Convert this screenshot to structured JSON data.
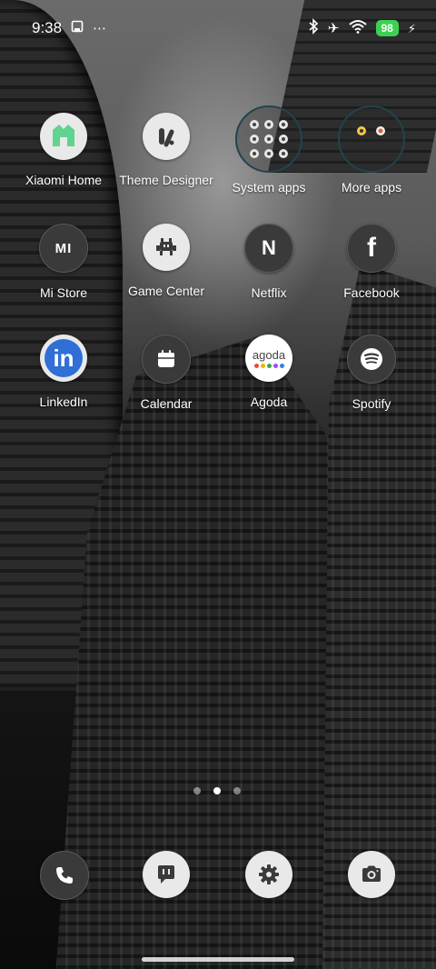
{
  "status_bar": {
    "time": "9:38",
    "left_icons": [
      "screenshot-icon",
      "more-notifications-icon"
    ],
    "right_icons": [
      "bluetooth-icon",
      "airplane-mode-icon",
      "wifi-icon",
      "charging-icon"
    ],
    "battery_level": "98",
    "battery_color": "#3dd153"
  },
  "apps": [
    {
      "name": "xiaomi-home",
      "label": "Xiaomi Home"
    },
    {
      "name": "theme-designer",
      "label": "Theme Designer"
    },
    {
      "name": "system-apps-folder",
      "label": "System apps"
    },
    {
      "name": "more-apps-folder",
      "label": "More apps"
    },
    {
      "name": "mi-store",
      "label": "Mi Store",
      "glyph": "MI"
    },
    {
      "name": "game-center",
      "label": "Game Center"
    },
    {
      "name": "netflix",
      "label": "Netflix",
      "glyph": "N"
    },
    {
      "name": "facebook",
      "label": "Facebook",
      "glyph": "f"
    },
    {
      "name": "linkedin",
      "label": "LinkedIn",
      "glyph": "in"
    },
    {
      "name": "calendar",
      "label": "Calendar"
    },
    {
      "name": "agoda",
      "label": "Agoda",
      "glyph": "agoda"
    },
    {
      "name": "spotify",
      "label": "Spotify"
    }
  ],
  "page_indicator": {
    "pages": 3,
    "current": 2
  },
  "dock": [
    {
      "name": "phone",
      "icon": "phone-icon"
    },
    {
      "name": "messages",
      "icon": "message-icon"
    },
    {
      "name": "settings",
      "icon": "gear-icon"
    },
    {
      "name": "camera",
      "icon": "camera-icon"
    }
  ],
  "colors": {
    "icon_light": "#e9e9e9",
    "icon_dark": "#3a3a3a",
    "linkedin_blue": "#2f6fd6",
    "xiaomi_home_green": "#5fd38f"
  }
}
